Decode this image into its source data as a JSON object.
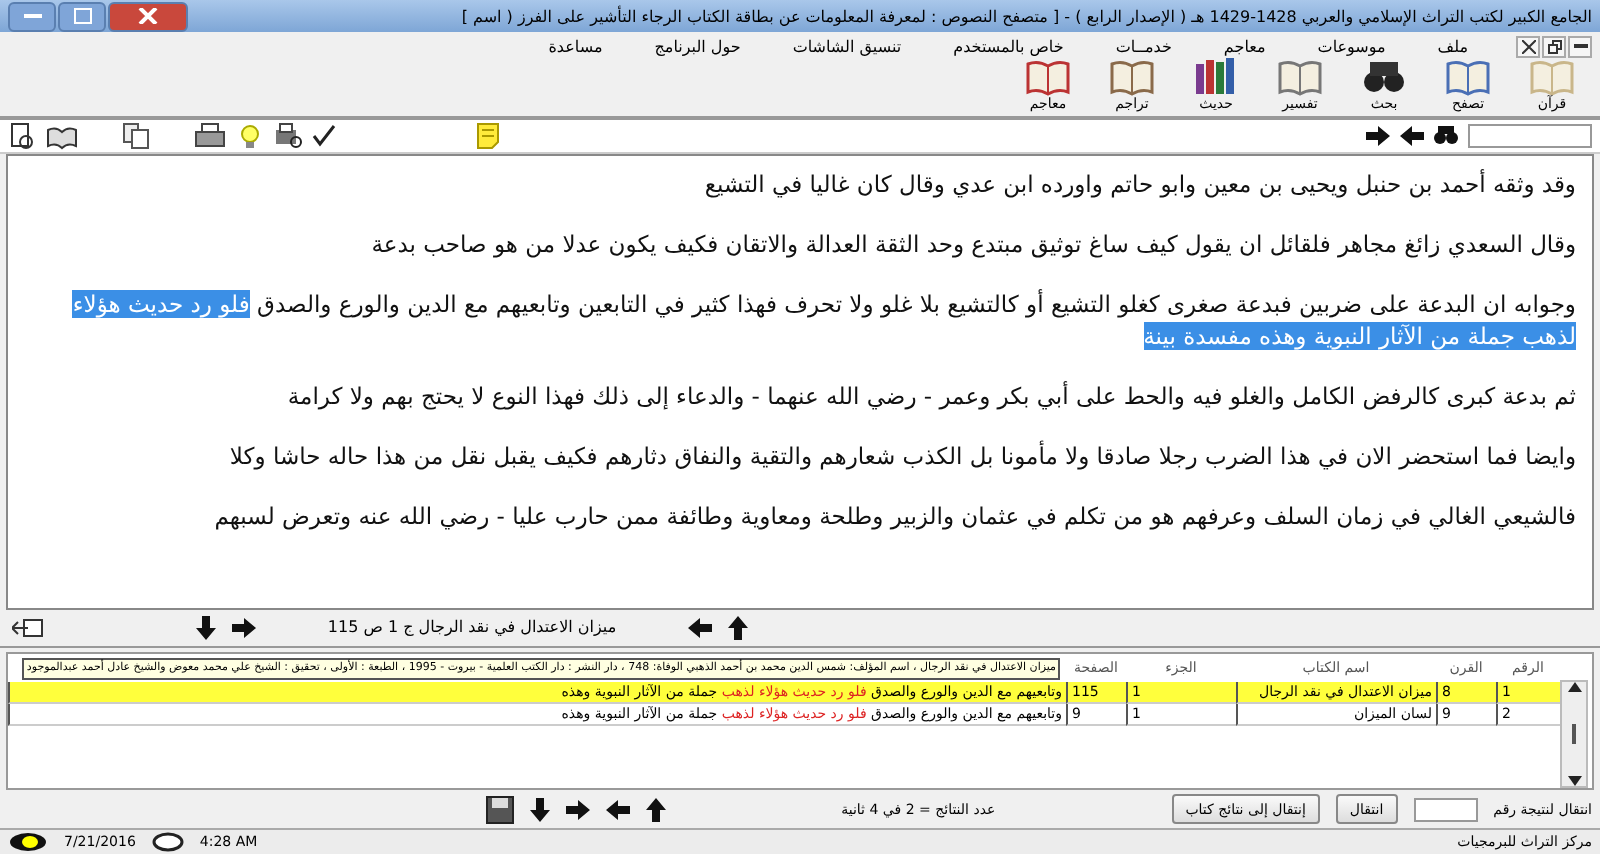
{
  "window": {
    "title": "الجامع الكبير لكتب التراث الإسلامي والعربي 1428-1429 هـ ( الإصدار الرابع ) - [ متصفح النصوص : لمعرفة المعلومات عن بطاقة الكتاب الرجاء التأشير على الفرز ( اسم ]"
  },
  "menu": [
    "ملف",
    "موسوعات",
    "معاجم",
    "خدمــات",
    "خاص بالمستخدم",
    "تنسيق الشاشات",
    "حول البرنامج",
    "مساعدة"
  ],
  "toolbar": [
    "قرآن",
    "تصفح",
    "بحث",
    "تفسير",
    "حديث",
    "تراجم",
    "معاجم"
  ],
  "document": {
    "paragraphs": [
      [
        {
          "text": "وقد وثقه أحمد بن حنبل ويحيى بن معين وابو حاتم واورده ابن عدي وقال كان غاليا في التشيع",
          "highlighted": false
        }
      ],
      [
        {
          "text": "وقال السعدي زائغ مجاهر فلقائل ان يقول كيف ساغ توثيق مبتدع وحد الثقة العدالة والاتقان فكيف يكون عدلا من هو صاحب بدعة",
          "highlighted": false
        }
      ],
      [
        {
          "text": "وجوابه ان البدعة على ضربين فبدعة صغرى كغلو التشيع أو كالتشيع بلا غلو ولا تحرف فهذا كثير في التابعين وتابعيهم مع الدين والورع والصدق ",
          "highlighted": false
        },
        {
          "text": "فلو رد حديث هؤلاء لذهب جملة من الآثار النبوية وهذه مفسدة بينة",
          "highlighted": true
        }
      ],
      [
        {
          "text": "ثم بدعة كبرى كالرفض الكامل والغلو فيه والحط على أبي بكر وعمر - رضي الله عنهما - والدعاء إلى ذلك فهذا النوع لا يحتج بهم ولا كرامة",
          "highlighted": false
        }
      ],
      [
        {
          "text": "وايضا فما استحضر الان في هذا الضرب رجلا صادقا ولا مأمونا بل الكذب شعارهم والتقية والنفاق دثارهم فكيف يقبل نقل من هذا حاله حاشا وكلا",
          "highlighted": false
        }
      ],
      [
        {
          "text": "فالشيعي الغالي في زمان السلف وعرفهم هو من تكلم في عثمان والزبير وطلحة ومعاوية وطائفة ممن حارب عليا - رضي الله عنه وتعرض لسبهم",
          "highlighted": false
        }
      ]
    ]
  },
  "nav": {
    "location": "ميزان الاعتدال في نقد الرجال ج 1 ص 115"
  },
  "results": {
    "columns": [
      "الرقم",
      "القرن",
      "اسم الكتاب",
      "الجزء",
      "الصفحة"
    ],
    "tooltip": "ميزان الاعتدال في نقد الرجال ، اسم المؤلف: شمس الدين محمد بن أحمد الذهبي الوفاة: 748 ، دار النشر : دار الكتب العلمية - بيروت - 1995 ، الطبعة : الأولى ، تحقيق : الشيخ علي محمد معوض والشيخ عادل أحمد عبدالموجود",
    "rows": [
      {
        "number": "1",
        "century": "8",
        "book": "ميزان الاعتدال في نقد الرجال",
        "volume": "1",
        "page": "115",
        "selected": true,
        "snippet": [
          {
            "text": "وتابعيهم مع الدين والورع والصدق ",
            "match": false
          },
          {
            "text": "فلو رد حديث هؤلاء لذهب",
            "match": true
          },
          {
            "text": " جملة من الآثار النبوية وهذه",
            "match": false
          }
        ]
      },
      {
        "number": "2",
        "century": "9",
        "book": "لسان الميزان",
        "volume": "1",
        "page": "9",
        "selected": false,
        "snippet": [
          {
            "text": "وتابعيهم مع الدين والورع والصدق ",
            "match": false
          },
          {
            "text": "فلو رد حديث هؤلاء لذهب",
            "match": true
          },
          {
            "text": " جملة من الآثار النبوية وهذه",
            "match": false
          }
        ]
      }
    ]
  },
  "footer": {
    "goto_label": "انتقال لنتيجة رقم",
    "goto_button": "انتقال",
    "book_results_button": "إنتقال إلى نتائج كتاب",
    "count": "عدد النتائج = 2 في 4 ثانية"
  },
  "status_bar": {
    "company": "مركز التراث للبرمجيات",
    "time": "4:28 AM",
    "date": "7/21/2016"
  }
}
